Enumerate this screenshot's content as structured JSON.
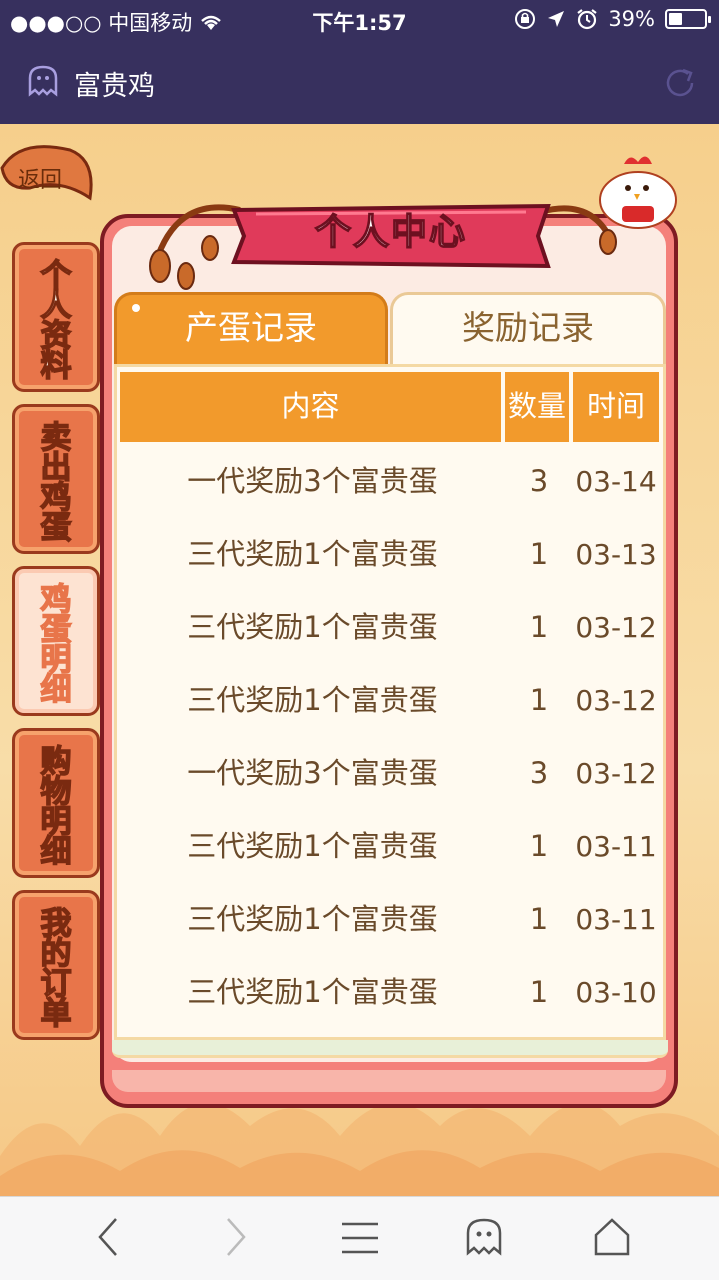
{
  "status_bar": {
    "carrier": "●●●○○ 中国移动",
    "time": "下午1:57",
    "battery": "39%",
    "battery_level": 0.39
  },
  "nav": {
    "title": "富贵鸡",
    "icons": [
      "ghost-icon",
      "refresh-icon"
    ]
  },
  "back_label": "返回",
  "header_title": "个人中心",
  "side_tabs": [
    {
      "label": "个人资料",
      "active": false
    },
    {
      "label": "卖出鸡蛋",
      "active": false
    },
    {
      "label": "鸡蛋明细",
      "active": true
    },
    {
      "label": "购物明细",
      "active": false
    },
    {
      "label": "我的订单",
      "active": false
    }
  ],
  "tabs": [
    {
      "label": "产蛋记录",
      "active": true
    },
    {
      "label": "奖励记录",
      "active": false
    }
  ],
  "table": {
    "headers": [
      "内容",
      "数量",
      "时间"
    ],
    "rows": [
      {
        "content": "一代奖励3个富贵蛋",
        "qty": "3",
        "time": "03-14"
      },
      {
        "content": "三代奖励1个富贵蛋",
        "qty": "1",
        "time": "03-13"
      },
      {
        "content": "三代奖励1个富贵蛋",
        "qty": "1",
        "time": "03-12"
      },
      {
        "content": "三代奖励1个富贵蛋",
        "qty": "1",
        "time": "03-12"
      },
      {
        "content": "一代奖励3个富贵蛋",
        "qty": "3",
        "time": "03-12"
      },
      {
        "content": "三代奖励1个富贵蛋",
        "qty": "1",
        "time": "03-11"
      },
      {
        "content": "三代奖励1个富贵蛋",
        "qty": "1",
        "time": "03-11"
      },
      {
        "content": "三代奖励1个富贵蛋",
        "qty": "1",
        "time": "03-10"
      }
    ]
  },
  "bottom_bar": {
    "icons": [
      "back-arrow-icon",
      "forward-arrow-icon",
      "menu-icon",
      "ghost-icon",
      "home-icon"
    ]
  },
  "colors": {
    "nav_bg": "#37305e",
    "accent_orange": "#f29a2c",
    "panel_red": "#f4807a",
    "text_brown": "#6a4a2a"
  }
}
